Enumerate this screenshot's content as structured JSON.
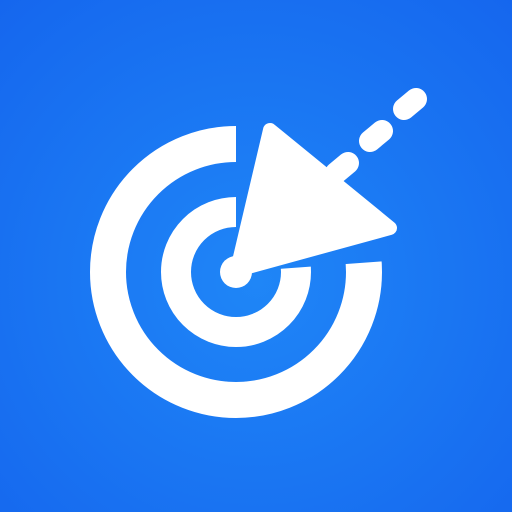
{
  "icon": {
    "name": "target-arrow-icon",
    "colors": {
      "background_gradient_start": "#1f86f7",
      "background_gradient_end": "#1566ee",
      "foreground": "#ffffff"
    }
  }
}
